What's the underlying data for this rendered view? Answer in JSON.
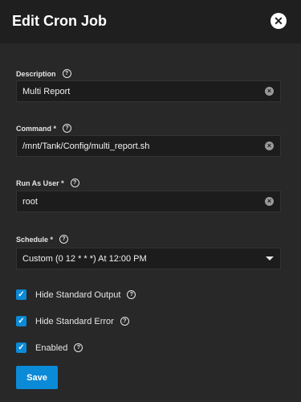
{
  "dialog": {
    "title": "Edit Cron Job"
  },
  "fields": {
    "description": {
      "label": "Description",
      "value": "Multi Report"
    },
    "command": {
      "label": "Command *",
      "value": "/mnt/Tank/Config/multi_report.sh"
    },
    "run_as_user": {
      "label": "Run As User *",
      "value": "root"
    },
    "schedule": {
      "label": "Schedule *",
      "value": "Custom (0 12 * * *) At 12:00 PM"
    }
  },
  "checkboxes": {
    "hide_stdout": {
      "label": "Hide Standard Output",
      "checked": true
    },
    "hide_stderr": {
      "label": "Hide Standard Error",
      "checked": true
    },
    "enabled": {
      "label": "Enabled",
      "checked": true
    }
  },
  "actions": {
    "save_label": "Save"
  },
  "icons": {
    "close": "close-icon",
    "help": "help-icon",
    "clear": "clear-icon",
    "caret": "caret-down-icon",
    "check": "check-icon"
  },
  "colors": {
    "accent": "#0b8ad7",
    "background": "#282828",
    "header": "#1f1f1f",
    "input": "#1c1c1c"
  }
}
